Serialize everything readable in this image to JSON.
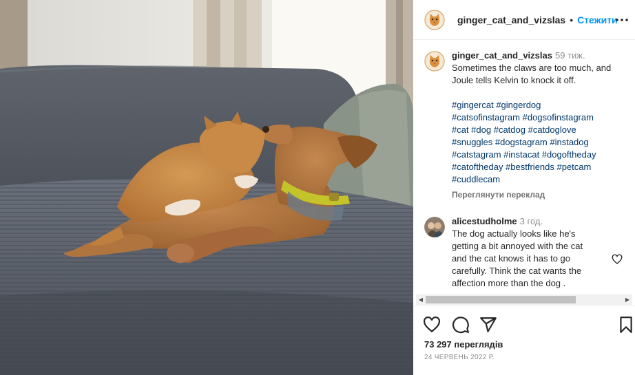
{
  "post": {
    "username": "ginger_cat_and_vizslas",
    "separator": "•",
    "follow_label": "Стежити",
    "more_icon": "more-horizontal-icon"
  },
  "caption": {
    "username": "ginger_cat_and_vizslas",
    "time": "59 тиж.",
    "text_lines": [
      "Sometimes the claws are too much, and",
      "Joule tells Kelvin to knock it off."
    ],
    "hashtag_lines": [
      "#gingercat #gingerdog",
      "#catsofinstagram #dogsofinstagram",
      "#cat #dog #catdog #catdoglove",
      "#snuggles #dogstagram #instadog",
      "#catstagram #instacat #dogoftheday",
      "#catoftheday #bestfriends #petcam",
      "#cuddlecam"
    ],
    "translate_label": "Переглянути переклад"
  },
  "comment": {
    "username": "alicestudholme",
    "time": "3 год.",
    "text_lines": [
      "The dog actually looks like he's",
      "getting a bit annoyed with the cat",
      "and the cat knows it has to go",
      "carefully. Think the cat wants the",
      "affection more than the dog ."
    ]
  },
  "footer": {
    "views": "73 297 переглядів",
    "date": "24 ЧЕРВЕНЬ 2022 Р."
  },
  "icons": {
    "like": "heart-icon",
    "comment": "comment-icon",
    "share": "paper-plane-icon",
    "save": "bookmark-icon"
  },
  "colors": {
    "accent": "#0095f6",
    "hashtag": "#00376b",
    "muted": "#8e8e8e"
  }
}
